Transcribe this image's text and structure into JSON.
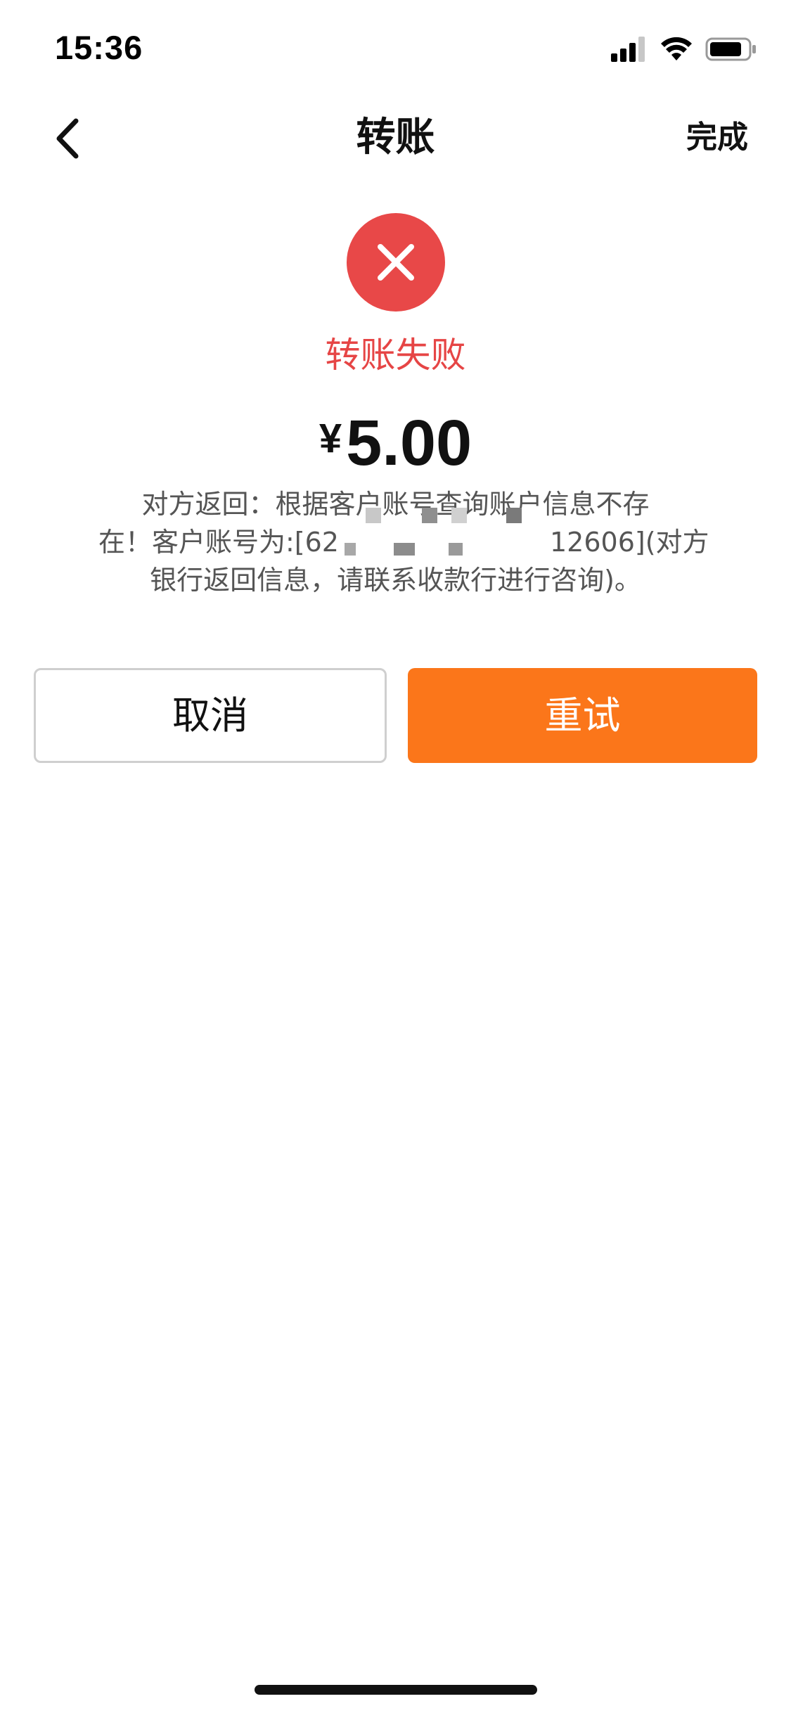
{
  "status_bar": {
    "time": "15:36"
  },
  "nav": {
    "title": "转账",
    "done_label": "完成"
  },
  "result": {
    "status_text": "转账失败",
    "currency_symbol": "¥",
    "amount": "5.00",
    "message_lines": [
      "对方返回：根据客户账号查询账户信息不存",
      "在！客户账号为:[62",
      "12606](对方",
      "银行返回信息，请联系收款行进行咨询)。"
    ]
  },
  "buttons": {
    "cancel": "取消",
    "retry": "重试"
  },
  "colors": {
    "error": "#e84848",
    "primary": "#fb761a"
  }
}
